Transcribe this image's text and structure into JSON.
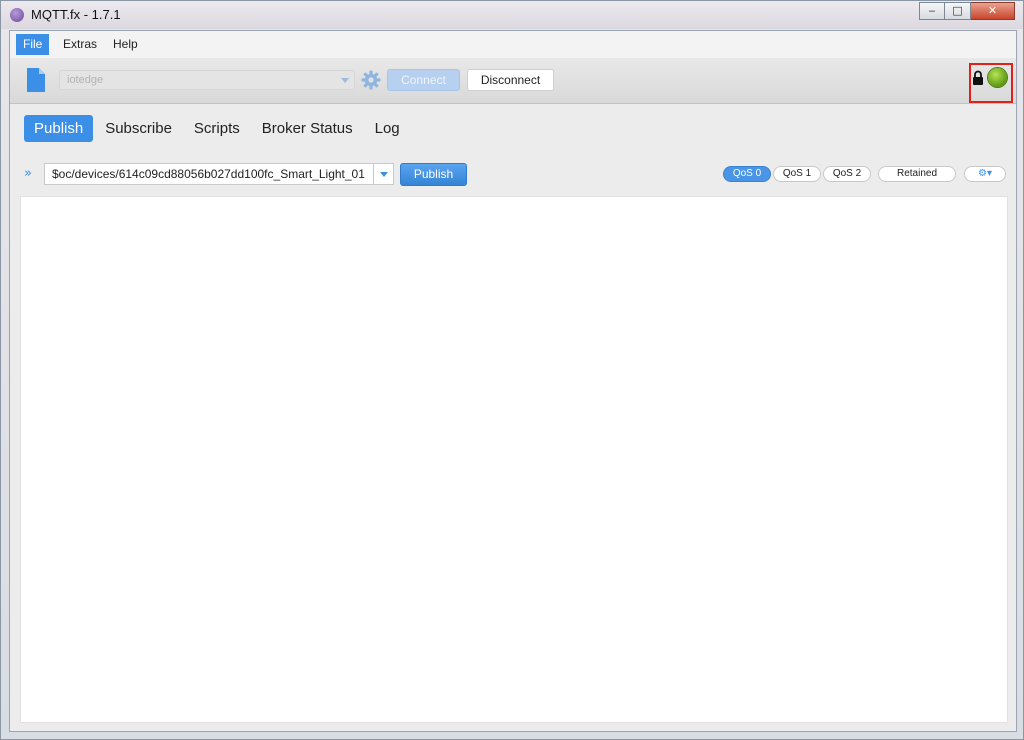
{
  "window": {
    "title": "MQTT.fx - 1.7.1",
    "minimize_glyph": "‒",
    "maximize_glyph": "□",
    "close_glyph": "✕"
  },
  "menu": [
    "File",
    "Extras",
    "Help"
  ],
  "toolbar": {
    "profile_value": "iotedge",
    "connect_label": "Connect",
    "disconnect_label": "Disconnect",
    "status_color": "#7ab82a"
  },
  "tabs": [
    "Publish",
    "Subscribe",
    "Scripts",
    "Broker Status",
    "Log"
  ],
  "publish": {
    "expand_glyph": "»",
    "topic_value": "$oc/devices/614c09cd88056b027dd100fc_Smart_Light_01",
    "publish_label": "Publish",
    "qos": [
      "QoS 0",
      "QoS 1",
      "QoS 2"
    ],
    "retained_label": "Retained",
    "settings_glyph": "⚙▾",
    "payload_value": ""
  },
  "colors": {
    "accent": "#3c8fe6",
    "highlight_box": "#e0201a"
  }
}
